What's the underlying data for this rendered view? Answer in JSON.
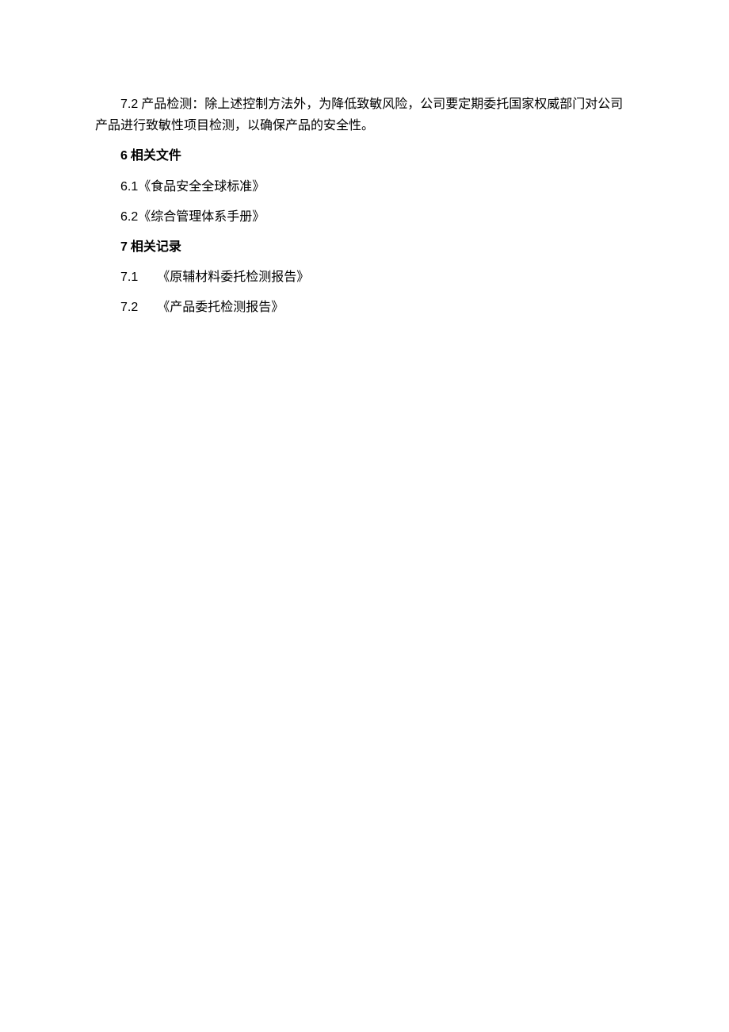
{
  "section72": {
    "number": "7.2",
    "text": "  产品检测：除上述控制方法外，为降低致敏风险，公司要定期委托国家权威部门对公司产品进行致敏性项目检测，以确保产品的安全性。"
  },
  "heading6": {
    "number": "6",
    "text": " 相关文件"
  },
  "item61": {
    "number": "6.1",
    "text": "《食品安全全球标准》"
  },
  "item62": {
    "number": "6.2",
    "text": "《综合管理体系手册》"
  },
  "heading7": {
    "number": "7",
    "text": " 相关记录"
  },
  "item71": {
    "number": "7.1",
    "text": "《原辅材料委托检测报告》"
  },
  "item72": {
    "number": "7.2",
    "text": "《产品委托检测报告》"
  }
}
